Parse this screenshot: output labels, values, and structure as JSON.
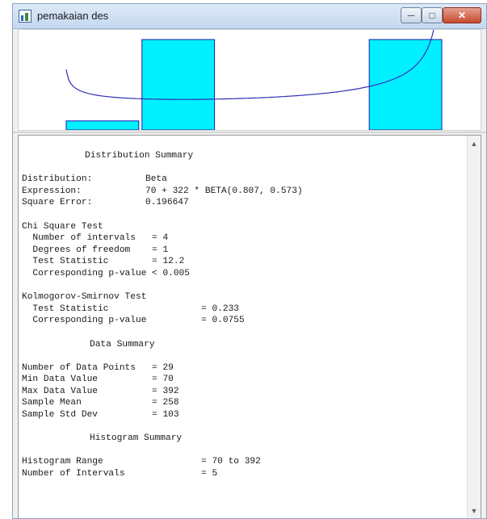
{
  "window": {
    "title": "pemakaian des",
    "controls": {
      "minimize": "─",
      "maximize": "□",
      "close": "✕"
    }
  },
  "chart_data": {
    "type": "bar",
    "bars": [
      {
        "x_start": 70,
        "x_end": 134.4,
        "value": 1
      },
      {
        "x_start": 134.4,
        "x_end": 198.8,
        "value": 10
      },
      {
        "x_start": 198.8,
        "x_end": 263.2,
        "value": 0
      },
      {
        "x_start": 263.2,
        "x_end": 327.6,
        "value": 0
      },
      {
        "x_start": 327.6,
        "x_end": 392,
        "value": 10
      }
    ],
    "fitted_curve": {
      "distribution": "Beta",
      "offset": 70,
      "scale": 322,
      "alpha": 0.807,
      "beta": 0.573
    },
    "xlim": [
      70,
      392
    ],
    "colors": {
      "bar_fill": "#00f0ff",
      "bar_stroke": "#1a1aa8",
      "curve": "#3030b8"
    }
  },
  "report": {
    "distribution_summary": {
      "heading": "Distribution Summary",
      "rows": [
        {
          "label": "Distribution:",
          "value": "Beta"
        },
        {
          "label": "Expression:",
          "value": "70 + 322 * BETA(0.807, 0.573)"
        },
        {
          "label": "Square Error:",
          "value": "0.196647"
        }
      ]
    },
    "chi_square": {
      "heading": "Chi Square Test",
      "rows": [
        {
          "label": "  Number of intervals",
          "op": "=",
          "value": "4"
        },
        {
          "label": "  Degrees of freedom",
          "op": "=",
          "value": "1"
        },
        {
          "label": "  Test Statistic",
          "op": "=",
          "value": "12.2"
        },
        {
          "label": "  Corresponding p-value",
          "op": "<",
          "value": "0.005"
        }
      ]
    },
    "ks_test": {
      "heading": "Kolmogorov-Smirnov Test",
      "rows": [
        {
          "label": "  Test Statistic",
          "op": "=",
          "value": "0.233"
        },
        {
          "label": "  Corresponding p-value",
          "op": "=",
          "value": "0.0755"
        }
      ]
    },
    "data_summary": {
      "heading": "Data Summary",
      "rows": [
        {
          "label": "Number of Data Points",
          "op": "=",
          "value": "29"
        },
        {
          "label": "Min Data Value",
          "op": "=",
          "value": "70"
        },
        {
          "label": "Max Data Value",
          "op": "=",
          "value": "392"
        },
        {
          "label": "Sample Mean",
          "op": "=",
          "value": "258"
        },
        {
          "label": "Sample Std Dev",
          "op": "=",
          "value": "103"
        }
      ]
    },
    "histogram_summary": {
      "heading": "Histogram Summary",
      "rows": [
        {
          "label": "Histogram Range",
          "op": "=",
          "value": "70 to 392"
        },
        {
          "label": "Number of Intervals",
          "op": "=",
          "value": "5"
        }
      ]
    }
  },
  "scrollbar": {
    "up_arrow": "▲",
    "down_arrow": "▼"
  }
}
